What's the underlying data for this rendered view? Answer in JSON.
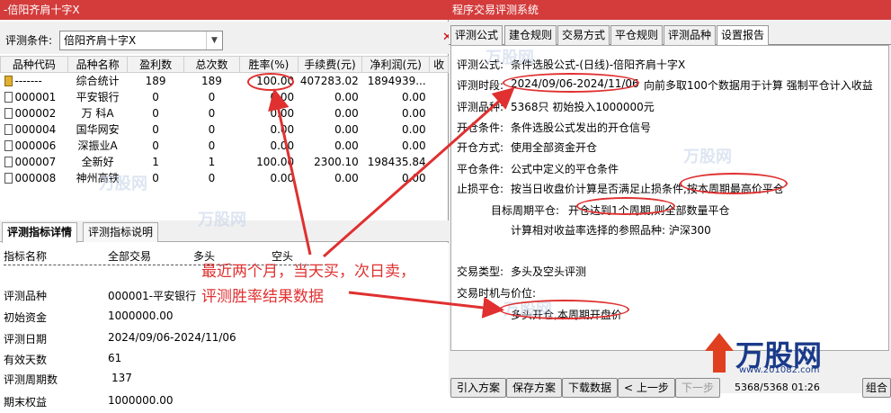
{
  "left_window": {
    "title": "-倍阳齐肩十字X",
    "condition_label": "评测条件:",
    "condition_value": "倍阳齐肩十字X",
    "table": {
      "headers": [
        "品种代码",
        "品种名称",
        "盈利数",
        "总次数",
        "胜率(%)",
        "手续费(元)",
        "净利润(元)",
        "收"
      ],
      "rows": [
        [
          "-------",
          "综合统计",
          "189",
          "189",
          "100.00",
          "407283.02",
          "1894939...",
          ""
        ],
        [
          "000001",
          "平安银行",
          "0",
          "0",
          "0.00",
          "0.00",
          "0.00",
          ""
        ],
        [
          "000002",
          "万 科A",
          "0",
          "0",
          "0.00",
          "0.00",
          "0.00",
          ""
        ],
        [
          "000004",
          "国华网安",
          "0",
          "0",
          "0.00",
          "0.00",
          "0.00",
          ""
        ],
        [
          "000006",
          "深振业A",
          "0",
          "0",
          "0.00",
          "0.00",
          "0.00",
          ""
        ],
        [
          "000007",
          "全新好",
          "1",
          "1",
          "100.00",
          "2300.10",
          "198435.84",
          ""
        ],
        [
          "000008",
          "神州高铁",
          "0",
          "0",
          "0.00",
          "0.00",
          "0.00",
          ""
        ]
      ]
    },
    "tabs": [
      "评测指标详情",
      "评测指标说明"
    ],
    "detail_header": [
      "指标名称",
      "全部交易",
      "多头",
      "空头"
    ],
    "detail_rows": [
      [
        "评测品种",
        "000001-平安银行"
      ],
      [
        "初始资金",
        "1000000.00"
      ],
      [
        "评测日期",
        "2024/09/06-2024/11/06"
      ],
      [
        "有效天数",
        "61"
      ],
      [
        "评测周期数",
        "137"
      ],
      [
        "期末权益",
        "1000000.00"
      ]
    ]
  },
  "right_window": {
    "title": "程序交易评测系统",
    "tabs": [
      "评测公式",
      "建仓规则",
      "交易方式",
      "平仓规则",
      "评测品种",
      "设置报告"
    ],
    "report": {
      "formula_label": "评测公式:",
      "formula_value": "条件选股公式-(日线)-倍阳齐肩十字X",
      "period_label": "评测时段:",
      "period_value": "2024/09/06-2024/11/06",
      "period_suffix": "向前多取100个数据用于计算 强制平仓计入收益",
      "stocks_label": "评测品种:",
      "stocks_value": "5368只 初始投入1000000元",
      "open_cond_label": "开仓条件:",
      "open_cond_value": "条件选股公式发出的开仓信号",
      "open_mode_label": "开仓方式:",
      "open_mode_value": "使用全部资金开仓",
      "close_cond_label": "平仓条件:",
      "close_cond_value": "公式中定义的平仓条件",
      "stop_label": "止损平仓:",
      "stop_value": "按当日收盘价计算是否满足止损条件,按本周期最高价平仓",
      "target_label": "目标周期平仓:",
      "target_value": "开仓达到1个周期,则全部数量平仓",
      "ref_value": "计算相对收益率选择的参照品种: 沪深300",
      "trade_type_label": "交易类型:",
      "trade_type_value": "多头及空头评测",
      "timing_label": "交易时机与价位:",
      "timing_value": "多头开仓,本周期开盘价"
    },
    "buttons": [
      "引入方案",
      "保存方案",
      "下载数据",
      "< 上一步",
      "下一步",
      "组合"
    ],
    "status": "5368/5368 01:26"
  },
  "annotation": {
    "line1": "最近两个月，当天买，次日卖，",
    "line2": "评测胜率结果数据"
  },
  "watermark": "万股网",
  "watermark_url": "www.201082.com",
  "colors": {
    "title_bar": "#d43c3c",
    "annotation": "#e03030"
  }
}
